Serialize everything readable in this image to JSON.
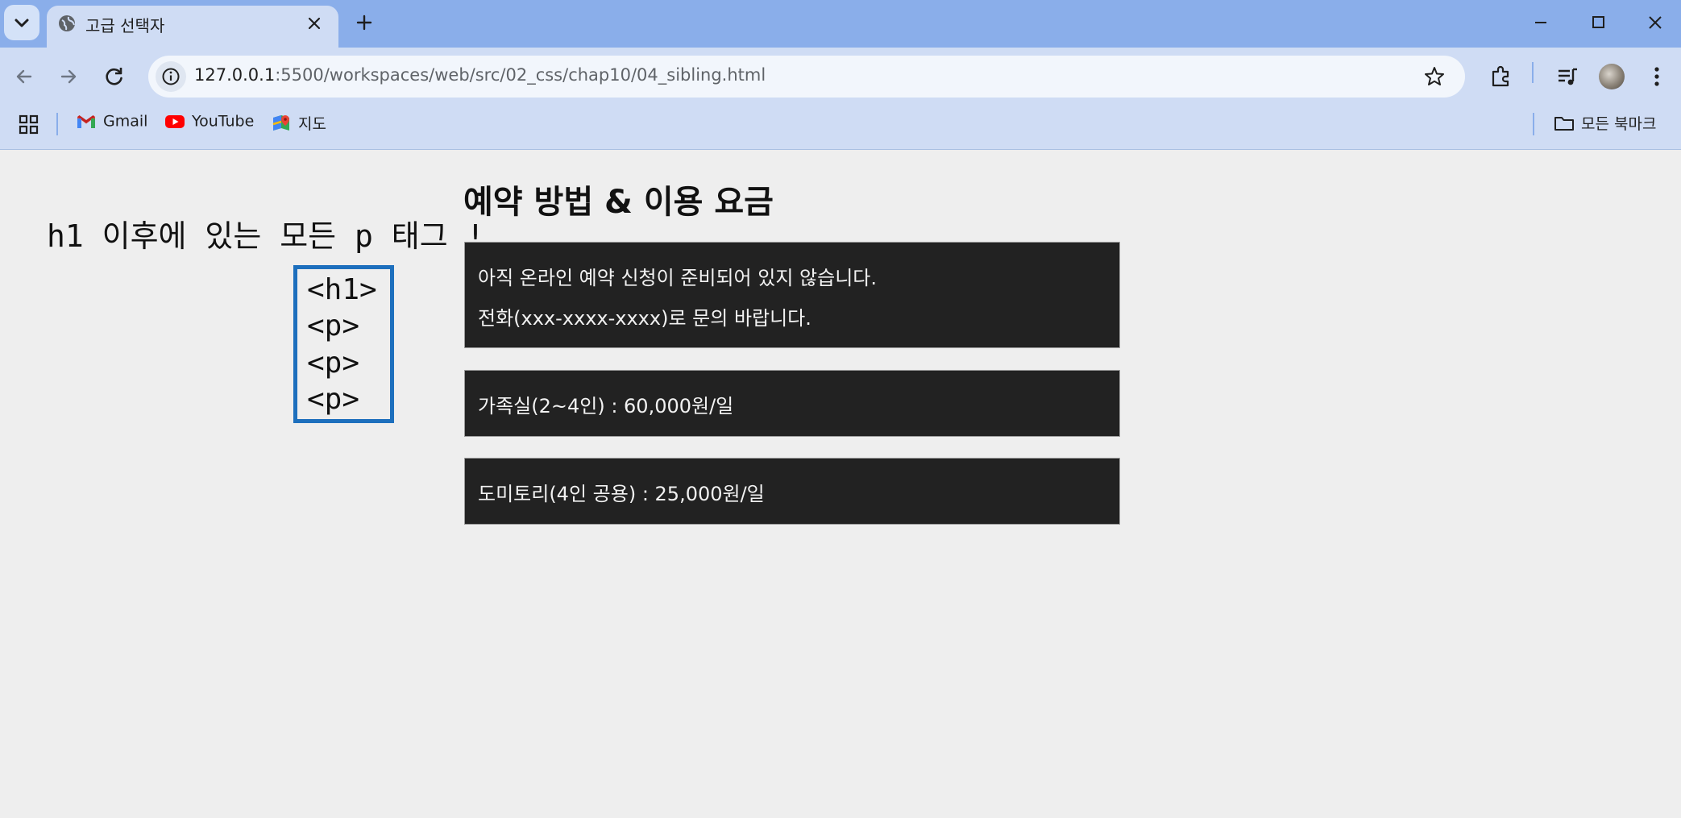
{
  "browser": {
    "tab": {
      "title": "고급 선택자"
    },
    "address": {
      "host": "127.0.0.1",
      "rest": ":5500/workspaces/web/src/02_css/chap10/04_sibling.html"
    },
    "bookmarks": [
      {
        "label": "Gmail",
        "icon": "gmail-icon"
      },
      {
        "label": "YouTube",
        "icon": "youtube-icon"
      },
      {
        "label": "지도",
        "icon": "maps-icon"
      }
    ],
    "all_bookmarks_label": "모든 북마크"
  },
  "annotation": {
    "text": "h1 이후에 있는 모든 p 태그 !",
    "tags": [
      "<h1>",
      "<p>",
      "<p>",
      "<p>"
    ]
  },
  "page": {
    "heading": "예약 방법 & 이용 요금",
    "boxes": [
      [
        "아직 온라인 예약 신청이 준비되어 있지 않습니다.",
        "전화(xxx-xxxx-xxxx)로 문의 바랍니다."
      ],
      [
        "가족실(2~4인) : 60,000원/일"
      ],
      [
        "도미토리(4인 공용) : 25,000원/일"
      ]
    ]
  },
  "colors": {
    "tabstrip": "#8aaeea",
    "toolbar": "#cfdcf4",
    "page_bg": "#eeeeee",
    "box_bg": "#222222",
    "annotation_border": "#1d6fbd"
  }
}
